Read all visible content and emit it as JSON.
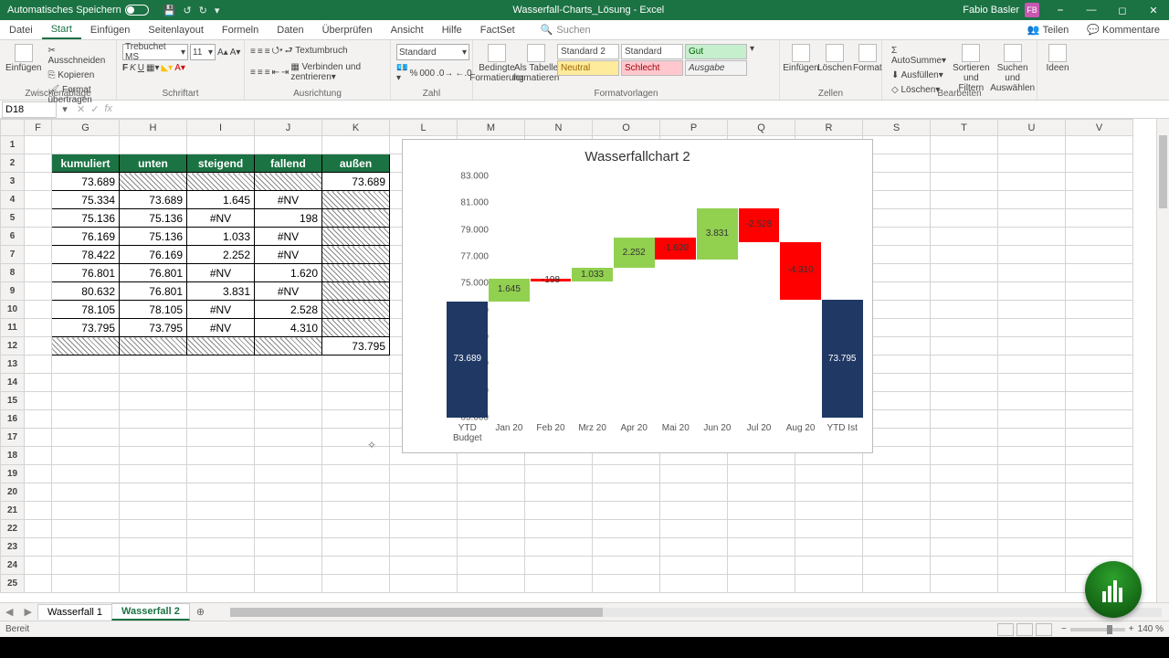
{
  "titlebar": {
    "autosave": "Automatisches Speichern",
    "doc": "Wasserfall-Charts_Lösung  -  Excel",
    "user": "Fabio Basler",
    "initials": "FB"
  },
  "tabs": {
    "datei": "Datei",
    "start": "Start",
    "einfuegen": "Einfügen",
    "seitenlayout": "Seitenlayout",
    "formeln": "Formeln",
    "daten": "Daten",
    "ueberpruefen": "Überprüfen",
    "ansicht": "Ansicht",
    "hilfe": "Hilfe",
    "factset": "FactSet",
    "suchen": "Suchen",
    "teilen": "Teilen",
    "kommentare": "Kommentare"
  },
  "ribbon": {
    "clip": {
      "paste": "Einfügen",
      "cut": "Ausschneiden",
      "copy": "Kopieren",
      "format": "Format übertragen",
      "label": "Zwischenablage"
    },
    "font": {
      "name": "Trebuchet MS",
      "size": "11",
      "label": "Schriftart"
    },
    "align": {
      "wrap": "Textumbruch",
      "merge": "Verbinden und zentrieren",
      "label": "Ausrichtung"
    },
    "number": {
      "format": "Standard",
      "label": "Zahl"
    },
    "styles": {
      "cond": "Bedingte Formatierung",
      "table": "Als Tabelle formatieren",
      "s1": "Standard 2",
      "s2": "Standard",
      "s3": "Gut",
      "s4": "Neutral",
      "s5": "Schlecht",
      "s6": "Ausgabe",
      "label": "Formatvorlagen"
    },
    "cells": {
      "insert": "Einfügen",
      "delete": "Löschen",
      "format": "Format",
      "label": "Zellen"
    },
    "edit": {
      "sum": "AutoSumme",
      "fill": "Ausfüllen",
      "clear": "Löschen",
      "sort": "Sortieren und Filtern",
      "find": "Suchen und Auswählen",
      "label": "Bearbeiten"
    },
    "ideas": {
      "btn": "Ideen"
    }
  },
  "namebox": "D18",
  "columns": [
    "F",
    "G",
    "H",
    "I",
    "J",
    "K",
    "L",
    "M",
    "N",
    "O",
    "P",
    "Q",
    "R",
    "S",
    "T",
    "U",
    "V"
  ],
  "tableHeaders": {
    "g": "kumuliert",
    "h": "unten",
    "i": "steigend",
    "j": "fallend",
    "k": "außen"
  },
  "tableRows": [
    {
      "g": "73.689",
      "h": "",
      "i": "",
      "j": "",
      "k": "73.689",
      "hatchedHIJ": true
    },
    {
      "g": "75.334",
      "h": "73.689",
      "i": "1.645",
      "j": "#NV",
      "k": "",
      "hatchedK": true
    },
    {
      "g": "75.136",
      "h": "75.136",
      "i": "#NV",
      "j": "198",
      "k": "",
      "hatchedK": true
    },
    {
      "g": "76.169",
      "h": "75.136",
      "i": "1.033",
      "j": "#NV",
      "k": "",
      "hatchedK": true
    },
    {
      "g": "78.422",
      "h": "76.169",
      "i": "2.252",
      "j": "#NV",
      "k": "",
      "hatchedK": true
    },
    {
      "g": "76.801",
      "h": "76.801",
      "i": "#NV",
      "j": "1.620",
      "k": "",
      "hatchedK": true
    },
    {
      "g": "80.632",
      "h": "76.801",
      "i": "3.831",
      "j": "#NV",
      "k": "",
      "hatchedK": true
    },
    {
      "g": "78.105",
      "h": "78.105",
      "i": "#NV",
      "j": "2.528",
      "k": "",
      "hatchedK": true
    },
    {
      "g": "73.795",
      "h": "73.795",
      "i": "#NV",
      "j": "4.310",
      "k": "",
      "hatchedK": true
    },
    {
      "g": "",
      "h": "",
      "i": "",
      "j": "",
      "k": "73.795",
      "hatchedGHIJ": true
    }
  ],
  "chart_data": {
    "type": "bar",
    "title": "Wasserfallchart 2",
    "ylim": [
      65000,
      83000
    ],
    "yticks": [
      "65.000",
      "67.000",
      "69.000",
      "71.000",
      "73.000",
      "75.000",
      "77.000",
      "79.000",
      "81.000",
      "83.000"
    ],
    "categories": [
      "YTD Budget",
      "Jan 20",
      "Feb 20",
      "Mrz 20",
      "Apr 20",
      "Mai 20",
      "Jun 20",
      "Jul 20",
      "Aug 20",
      "YTD Ist"
    ],
    "series": [
      {
        "name": "unten",
        "role": "invisible",
        "values": [
          0,
          73689,
          75136,
          75136,
          76169,
          76801,
          76801,
          78105,
          73795,
          0
        ]
      },
      {
        "name": "steigend",
        "role": "up",
        "values": [
          null,
          1645,
          null,
          1033,
          2252,
          null,
          3831,
          null,
          null,
          null
        ]
      },
      {
        "name": "fallend",
        "role": "down",
        "values": [
          null,
          null,
          198,
          null,
          null,
          1620,
          null,
          2528,
          4310,
          null
        ]
      },
      {
        "name": "außen",
        "role": "total",
        "values": [
          73689,
          null,
          null,
          null,
          null,
          null,
          null,
          null,
          null,
          73795
        ]
      }
    ],
    "labels": [
      "73.689",
      "1.645",
      "-198",
      "1.033",
      "2.252",
      "-1.620",
      "3.831",
      "-2.528",
      "-4.310",
      "73.795"
    ]
  },
  "sheets": {
    "s1": "Wasserfall 1",
    "s2": "Wasserfall 2"
  },
  "status": {
    "ready": "Bereit",
    "zoom": "140 %"
  }
}
